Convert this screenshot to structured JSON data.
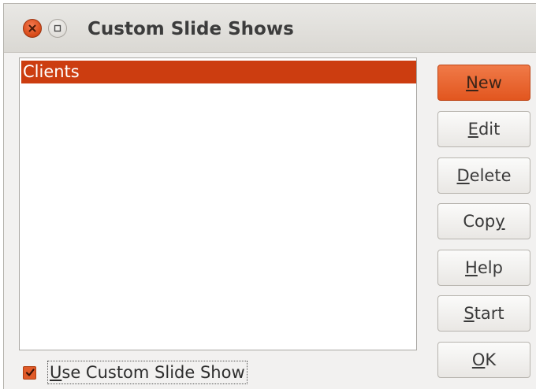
{
  "window": {
    "title": "Custom Slide Shows"
  },
  "list": {
    "items": [
      "Clients"
    ],
    "selected_index": 0
  },
  "buttons": {
    "new": "New",
    "edit": "Edit",
    "delete": "Delete",
    "copy": "Copy",
    "help": "Help",
    "start": "Start",
    "ok": "OK"
  },
  "checkbox": {
    "label": "Use Custom Slide Show",
    "checked": true
  },
  "colors": {
    "accent": "#e2561f",
    "selection": "#cc3d10",
    "dialog_bg": "#f2f1f0"
  },
  "icons": [
    "close-icon",
    "maximize-icon",
    "checkmark-icon"
  ]
}
